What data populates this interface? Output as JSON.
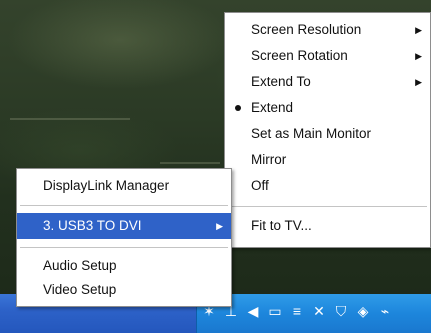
{
  "left_menu": {
    "items": [
      {
        "label": "DisplayLink Manager"
      },
      {
        "label": "3. USB3 TO DVI",
        "submenu": true,
        "selected": true
      },
      {
        "label": "Audio Setup"
      },
      {
        "label": "Video Setup"
      }
    ]
  },
  "submenu": {
    "items": [
      {
        "label": "Screen Resolution",
        "submenu": true
      },
      {
        "label": "Screen Rotation",
        "submenu": true
      },
      {
        "label": "Extend To",
        "submenu": true
      },
      {
        "label": "Extend",
        "checked": true
      },
      {
        "label": "Set as Main Monitor"
      },
      {
        "label": "Mirror"
      },
      {
        "label": "Off"
      },
      {
        "label": "Fit to TV..."
      }
    ]
  },
  "tray_icons": [
    "displaylink-icon",
    "network-icon",
    "volume-icon",
    "monitor-icon",
    "wireless-icon",
    "alert-icon",
    "shield-icon",
    "security-center-icon",
    "usb-icon"
  ],
  "colors": {
    "menu_highlight": "#2f62c8",
    "taskbar": "#2457bd",
    "tray": "#1d86dc"
  }
}
